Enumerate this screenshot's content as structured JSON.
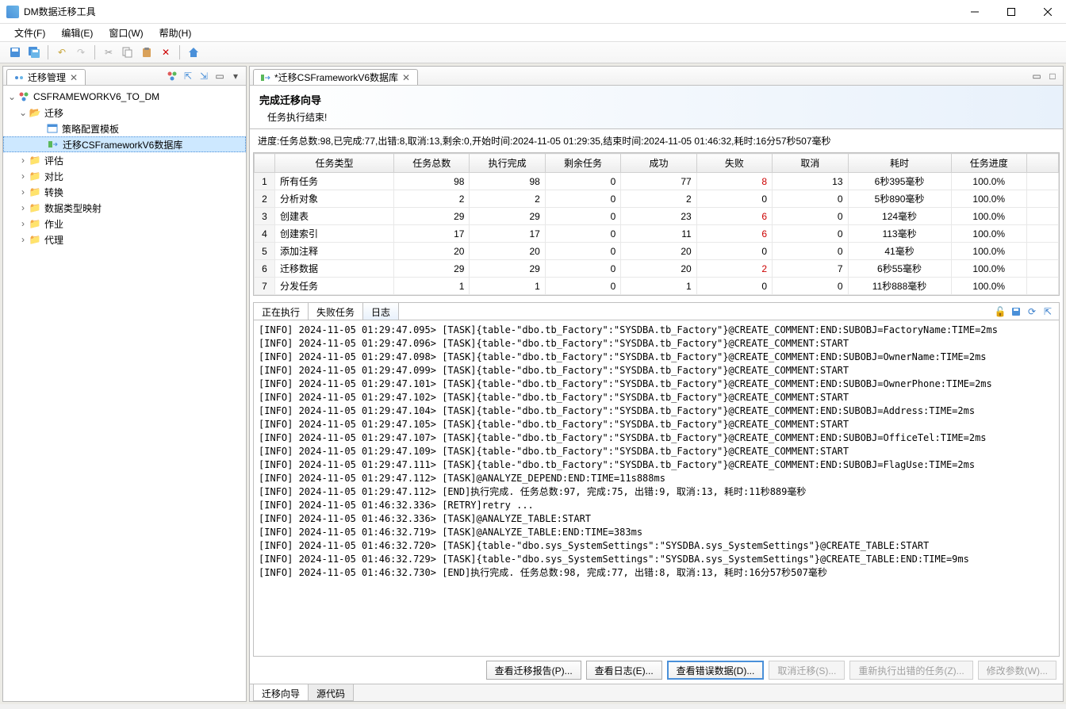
{
  "title": "DM数据迁移工具",
  "menu": [
    "文件(F)",
    "编辑(E)",
    "窗口(W)",
    "帮助(H)"
  ],
  "left_tab": "迁移管理",
  "right_tab": "*迁移CSFrameworkV6数据库",
  "tree": {
    "root": "CSFRAMEWORKV6_TO_DM",
    "migrate": "迁移",
    "migrate_children": [
      "策略配置模板",
      "迁移CSFrameworkV6数据库"
    ],
    "others": [
      "评估",
      "对比",
      "转换",
      "数据类型映射",
      "作业",
      "代理"
    ]
  },
  "wizard": {
    "title": "完成迁移向导",
    "subtitle": "任务执行结束!"
  },
  "progress": "进度:任务总数:98,已完成:77,出错:8,取消:13,剩余:0,开始时间:2024-11-05 01:29:35,结束时间:2024-11-05 01:46:32,耗时:16分57秒507毫秒",
  "columns": [
    "任务类型",
    "任务总数",
    "执行完成",
    "剩余任务",
    "成功",
    "失败",
    "取消",
    "耗时",
    "任务进度"
  ],
  "rows": [
    {
      "n": "1",
      "type": "所有任务",
      "total": "98",
      "done": "98",
      "remain": "0",
      "ok": "77",
      "fail": "8",
      "cancel": "13",
      "time": "6秒395毫秒",
      "prog": "100.0%"
    },
    {
      "n": "2",
      "type": "分析对象",
      "total": "2",
      "done": "2",
      "remain": "0",
      "ok": "2",
      "fail": "0",
      "cancel": "0",
      "time": "5秒890毫秒",
      "prog": "100.0%"
    },
    {
      "n": "3",
      "type": "创建表",
      "total": "29",
      "done": "29",
      "remain": "0",
      "ok": "23",
      "fail": "6",
      "cancel": "0",
      "time": "124毫秒",
      "prog": "100.0%"
    },
    {
      "n": "4",
      "type": "创建索引",
      "total": "17",
      "done": "17",
      "remain": "0",
      "ok": "11",
      "fail": "6",
      "cancel": "0",
      "time": "113毫秒",
      "prog": "100.0%"
    },
    {
      "n": "5",
      "type": "添加注释",
      "total": "20",
      "done": "20",
      "remain": "0",
      "ok": "20",
      "fail": "0",
      "cancel": "0",
      "time": "41毫秒",
      "prog": "100.0%"
    },
    {
      "n": "6",
      "type": "迁移数据",
      "total": "29",
      "done": "29",
      "remain": "0",
      "ok": "20",
      "fail": "2",
      "cancel": "7",
      "time": "6秒55毫秒",
      "prog": "100.0%"
    },
    {
      "n": "7",
      "type": "分发任务",
      "total": "1",
      "done": "1",
      "remain": "0",
      "ok": "1",
      "fail": "0",
      "cancel": "0",
      "time": "11秒888毫秒",
      "prog": "100.0%"
    }
  ],
  "sub_tabs": [
    "正在执行",
    "失败任务",
    "日志"
  ],
  "log": [
    "[INFO] 2024-11-05 01:29:47.095> [TASK]{table-\"dbo.tb_Factory\":\"SYSDBA.tb_Factory\"}@CREATE_COMMENT:END:SUBOBJ=FactoryName:TIME=2ms",
    "[INFO] 2024-11-05 01:29:47.096> [TASK]{table-\"dbo.tb_Factory\":\"SYSDBA.tb_Factory\"}@CREATE_COMMENT:START",
    "[INFO] 2024-11-05 01:29:47.098> [TASK]{table-\"dbo.tb_Factory\":\"SYSDBA.tb_Factory\"}@CREATE_COMMENT:END:SUBOBJ=OwnerName:TIME=2ms",
    "[INFO] 2024-11-05 01:29:47.099> [TASK]{table-\"dbo.tb_Factory\":\"SYSDBA.tb_Factory\"}@CREATE_COMMENT:START",
    "[INFO] 2024-11-05 01:29:47.101> [TASK]{table-\"dbo.tb_Factory\":\"SYSDBA.tb_Factory\"}@CREATE_COMMENT:END:SUBOBJ=OwnerPhone:TIME=2ms",
    "[INFO] 2024-11-05 01:29:47.102> [TASK]{table-\"dbo.tb_Factory\":\"SYSDBA.tb_Factory\"}@CREATE_COMMENT:START",
    "[INFO] 2024-11-05 01:29:47.104> [TASK]{table-\"dbo.tb_Factory\":\"SYSDBA.tb_Factory\"}@CREATE_COMMENT:END:SUBOBJ=Address:TIME=2ms",
    "[INFO] 2024-11-05 01:29:47.105> [TASK]{table-\"dbo.tb_Factory\":\"SYSDBA.tb_Factory\"}@CREATE_COMMENT:START",
    "[INFO] 2024-11-05 01:29:47.107> [TASK]{table-\"dbo.tb_Factory\":\"SYSDBA.tb_Factory\"}@CREATE_COMMENT:END:SUBOBJ=OfficeTel:TIME=2ms",
    "[INFO] 2024-11-05 01:29:47.109> [TASK]{table-\"dbo.tb_Factory\":\"SYSDBA.tb_Factory\"}@CREATE_COMMENT:START",
    "[INFO] 2024-11-05 01:29:47.111> [TASK]{table-\"dbo.tb_Factory\":\"SYSDBA.tb_Factory\"}@CREATE_COMMENT:END:SUBOBJ=FlagUse:TIME=2ms",
    "[INFO] 2024-11-05 01:29:47.112> [TASK]@ANALYZE_DEPEND:END:TIME=11s888ms",
    "[INFO] 2024-11-05 01:29:47.112> [END]执行完成. 任务总数:97, 完成:75, 出错:9, 取消:13, 耗时:11秒889毫秒",
    "[INFO] 2024-11-05 01:46:32.336> [RETRY]retry ...",
    "[INFO] 2024-11-05 01:46:32.336> [TASK]@ANALYZE_TABLE:START",
    "[INFO] 2024-11-05 01:46:32.719> [TASK]@ANALYZE_TABLE:END:TIME=383ms",
    "[INFO] 2024-11-05 01:46:32.720> [TASK]{table-\"dbo.sys_SystemSettings\":\"SYSDBA.sys_SystemSettings\"}@CREATE_TABLE:START",
    "[INFO] 2024-11-05 01:46:32.729> [TASK]{table-\"dbo.sys_SystemSettings\":\"SYSDBA.sys_SystemSettings\"}@CREATE_TABLE:END:TIME=9ms",
    "[INFO] 2024-11-05 01:46:32.730> [END]执行完成. 任务总数:98, 完成:77, 出错:8, 取消:13, 耗时:16分57秒507毫秒"
  ],
  "buttons": {
    "report": "查看迁移报告(P)...",
    "log": "查看日志(E)...",
    "error": "查看错误数据(D)...",
    "cancel": "取消迁移(S)...",
    "retry": "重新执行出错的任务(Z)...",
    "params": "修改参数(W)..."
  },
  "bottom_tabs": [
    "迁移向导",
    "源代码"
  ]
}
